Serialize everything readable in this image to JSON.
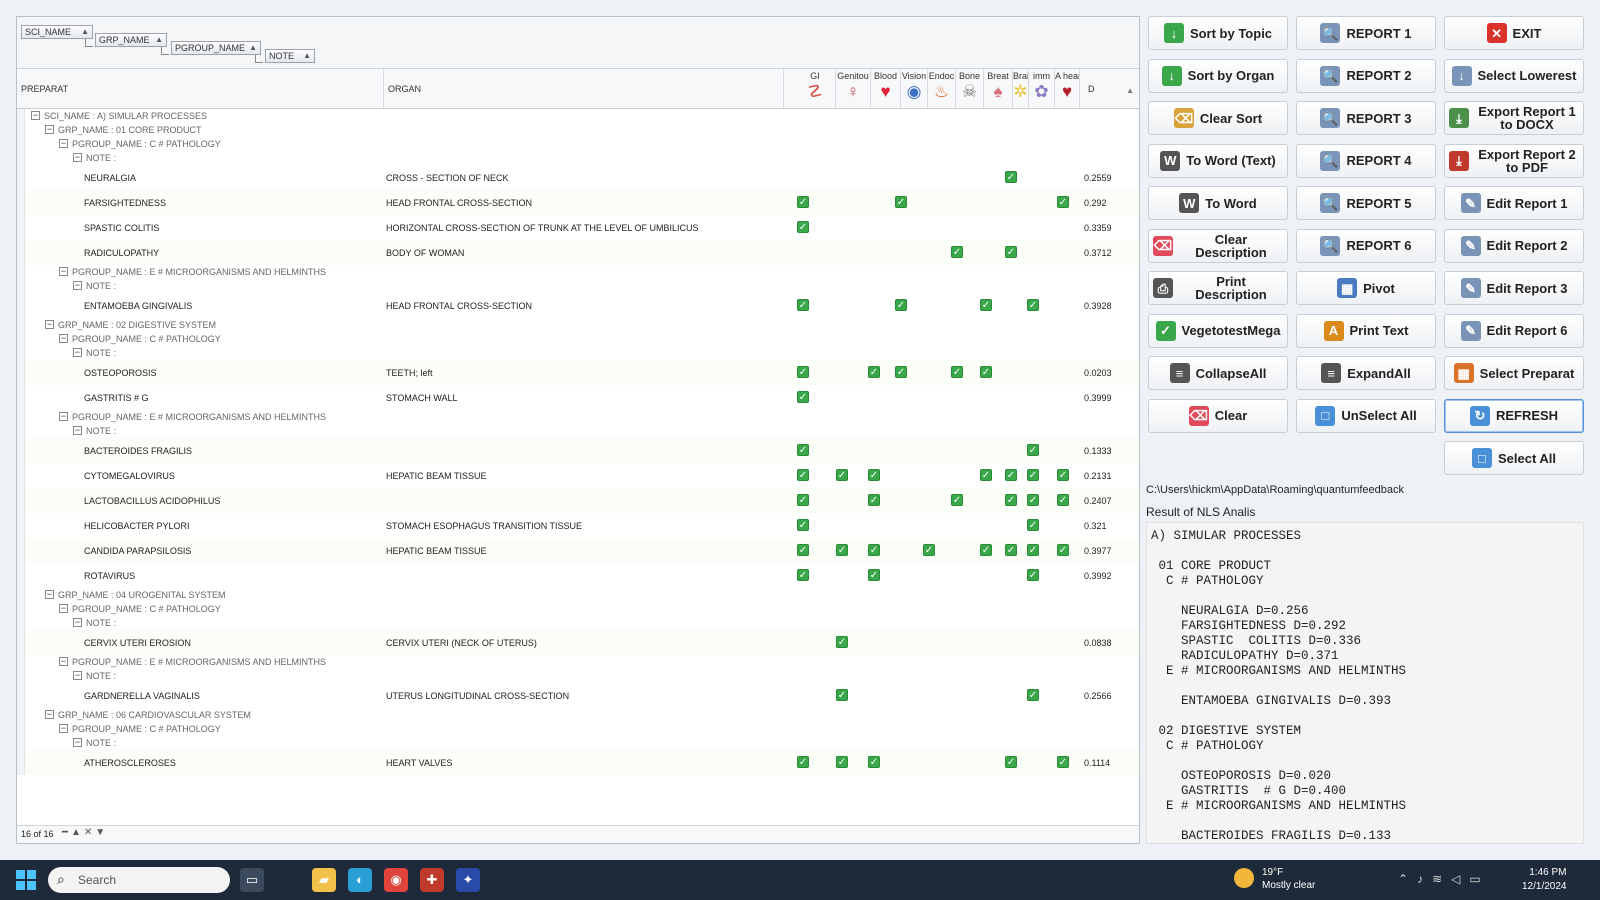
{
  "group_panel": {
    "chips": [
      {
        "label": "SCI_NAME"
      },
      {
        "label": "GRP_NAME"
      },
      {
        "label": "PGROUP_NAME"
      },
      {
        "label": "NOTE"
      }
    ]
  },
  "columns": {
    "preparat": "PREPARAT",
    "organ": "ORGAN",
    "d": "D",
    "organs": [
      {
        "label": "GI",
        "icon": "intestine-icon",
        "glyph": "☡",
        "color": "#d94a3a"
      },
      {
        "label": "Genitou",
        "icon": "uterus-icon",
        "glyph": "♀",
        "color": "#c9445a"
      },
      {
        "label": "Blood",
        "icon": "heart-blood-icon",
        "glyph": "♥",
        "color": "#e0243b"
      },
      {
        "label": "Vision",
        "icon": "eye-icon",
        "glyph": "◉",
        "color": "#3b6fc4"
      },
      {
        "label": "Endoc",
        "icon": "thyroid-icon",
        "glyph": "♨",
        "color": "#e06b1a"
      },
      {
        "label": "Bone",
        "icon": "skull-icon",
        "glyph": "☠",
        "color": "#777777"
      },
      {
        "label": "Breat",
        "icon": "lungs-icon",
        "glyph": "♠",
        "color": "#d9737a"
      },
      {
        "label": "Brai",
        "icon": "brain-icon",
        "glyph": "✲",
        "color": "#e8c43a"
      },
      {
        "label": "imm",
        "icon": "immune-icon",
        "glyph": "✿",
        "color": "#8c7ac0"
      },
      {
        "label": "A heart",
        "icon": "heart-icon",
        "glyph": "♥",
        "color": "#b81d2a"
      }
    ]
  },
  "rows": [
    {
      "kind": "group",
      "level": 0,
      "label": "SCI_NAME : A) SIMULAR PROCESSES"
    },
    {
      "kind": "group",
      "level": 1,
      "label": "GRP_NAME : 01 CORE PRODUCT"
    },
    {
      "kind": "group",
      "level": 2,
      "label": "PGROUP_NAME : C # PATHOLOGY"
    },
    {
      "kind": "group",
      "level": 3,
      "label": "NOTE :"
    },
    {
      "kind": "data",
      "preparat": "NEURALGIA",
      "organ": "CROSS - SECTION  OF  NECK",
      "checks": [
        0,
        0,
        0,
        0,
        0,
        0,
        0,
        1,
        0,
        0
      ],
      "d": "0.2559"
    },
    {
      "kind": "data",
      "preparat": "FARSIGHTEDNESS",
      "organ": "HEAD FRONTAL CROSS-SECTION",
      "checks": [
        1,
        0,
        0,
        1,
        0,
        0,
        0,
        0,
        0,
        1
      ],
      "d": "0.292"
    },
    {
      "kind": "data",
      "preparat": "SPASTIC  COLITIS",
      "organ": "HORIZONTAL CROSS-SECTION OF TRUNK AT THE LEVEL OF UMBILICUS",
      "checks": [
        1,
        0,
        0,
        0,
        0,
        0,
        0,
        0,
        0,
        0
      ],
      "d": "0.3359"
    },
    {
      "kind": "data",
      "preparat": "RADICULOPATHY",
      "organ": "BODY OF WOMAN",
      "checks": [
        0,
        0,
        0,
        0,
        0,
        1,
        0,
        1,
        0,
        0
      ],
      "d": "0.3712"
    },
    {
      "kind": "group",
      "level": 2,
      "label": "PGROUP_NAME : E # MICROORGANISMS AND HELMINTHS"
    },
    {
      "kind": "group",
      "level": 3,
      "label": "NOTE :"
    },
    {
      "kind": "data",
      "preparat": "ENTAMOEBA GINGIVALIS",
      "organ": "HEAD FRONTAL CROSS-SECTION",
      "checks": [
        1,
        0,
        0,
        1,
        0,
        0,
        1,
        0,
        1,
        0
      ],
      "d": "0.3928"
    },
    {
      "kind": "group",
      "level": 1,
      "label": "GRP_NAME : 02 DIGESTIVE SYSTEM"
    },
    {
      "kind": "group",
      "level": 2,
      "label": "PGROUP_NAME : C # PATHOLOGY"
    },
    {
      "kind": "group",
      "level": 3,
      "label": "NOTE :"
    },
    {
      "kind": "data",
      "preparat": "OSTEOPOROSIS",
      "organ": "TEETH; left",
      "checks": [
        1,
        0,
        1,
        1,
        0,
        1,
        1,
        0,
        0,
        0
      ],
      "d": "0.0203"
    },
    {
      "kind": "data",
      "preparat": "GASTRITIS  # G",
      "organ": "STOMACH WALL",
      "checks": [
        1,
        0,
        0,
        0,
        0,
        0,
        0,
        0,
        0,
        0
      ],
      "d": "0.3999"
    },
    {
      "kind": "group",
      "level": 2,
      "label": "PGROUP_NAME : E # MICROORGANISMS AND HELMINTHS"
    },
    {
      "kind": "group",
      "level": 3,
      "label": "NOTE :"
    },
    {
      "kind": "data",
      "preparat": "BACTEROIDES FRAGILIS",
      "organ": "",
      "checks": [
        1,
        0,
        0,
        0,
        0,
        0,
        0,
        0,
        1,
        0
      ],
      "d": "0.1333"
    },
    {
      "kind": "data",
      "preparat": "CYTOMEGALOVIRUS",
      "organ": "HEPATIC  BEAM TISSUE",
      "checks": [
        1,
        1,
        1,
        0,
        0,
        0,
        1,
        1,
        1,
        1
      ],
      "d": "0.2131"
    },
    {
      "kind": "data",
      "preparat": "LACTOBACILLUS ACIDOPHILUS",
      "organ": "",
      "checks": [
        1,
        0,
        1,
        0,
        0,
        1,
        0,
        1,
        1,
        1
      ],
      "d": "0.2407"
    },
    {
      "kind": "data",
      "preparat": "HELICOBACTER PYLORI",
      "organ": "STOMACH ESOPHAGUS TRANSITION TISSUE",
      "checks": [
        1,
        0,
        0,
        0,
        0,
        0,
        0,
        0,
        1,
        0
      ],
      "d": "0.321"
    },
    {
      "kind": "data",
      "preparat": "CANDIDA PARAPSILOSIS",
      "organ": "HEPATIC  BEAM TISSUE",
      "checks": [
        1,
        1,
        1,
        0,
        1,
        0,
        1,
        1,
        1,
        1
      ],
      "d": "0.3977"
    },
    {
      "kind": "data",
      "preparat": "ROTAVIRUS",
      "organ": "",
      "checks": [
        1,
        0,
        1,
        0,
        0,
        0,
        0,
        0,
        1,
        0
      ],
      "d": "0.3992"
    },
    {
      "kind": "group",
      "level": 1,
      "label": "GRP_NAME : 04 UROGENITAL SYSTEM"
    },
    {
      "kind": "group",
      "level": 2,
      "label": "PGROUP_NAME : C # PATHOLOGY"
    },
    {
      "kind": "group",
      "level": 3,
      "label": "NOTE :"
    },
    {
      "kind": "data",
      "preparat": "CERVIX  UTERI  EROSION",
      "organ": "CERVIX  UTERI (NECK OF UTERUS)",
      "checks": [
        0,
        1,
        0,
        0,
        0,
        0,
        0,
        0,
        0,
        0
      ],
      "d": "0.0838"
    },
    {
      "kind": "group",
      "level": 2,
      "label": "PGROUP_NAME : E # MICROORGANISMS AND HELMINTHS"
    },
    {
      "kind": "group",
      "level": 3,
      "label": "NOTE :"
    },
    {
      "kind": "data",
      "preparat": "GARDNERELLA VAGINALIS",
      "organ": "UTERUS LONGITUDINAL CROSS-SECTION",
      "checks": [
        0,
        1,
        0,
        0,
        0,
        0,
        0,
        0,
        1,
        0
      ],
      "d": "0.2566"
    },
    {
      "kind": "group",
      "level": 1,
      "label": "GRP_NAME : 06 CARDIOVASCULAR SYSTEM"
    },
    {
      "kind": "group",
      "level": 2,
      "label": "PGROUP_NAME : C # PATHOLOGY"
    },
    {
      "kind": "group",
      "level": 3,
      "label": "NOTE :"
    },
    {
      "kind": "data",
      "preparat": "ATHEROSCLEROSES",
      "organ": "HEART VALVES",
      "checks": [
        1,
        1,
        1,
        0,
        0,
        0,
        0,
        1,
        0,
        1
      ],
      "d": "0.1114"
    }
  ],
  "grid_footer": {
    "count": "16 of 16"
  },
  "buttons": [
    {
      "label": "Sort by Topic",
      "icon": "sort-az-icon",
      "glyph": "↓",
      "color": "#3aa84a"
    },
    {
      "label": "REPORT 1",
      "icon": "report-icon",
      "glyph": "🔍",
      "color": "#7a94b8"
    },
    {
      "label": "EXIT",
      "icon": "close-icon",
      "glyph": "✕",
      "color": "#d9332b"
    },
    {
      "label": "Sort by Organ",
      "icon": "sort-az-icon",
      "glyph": "↓",
      "color": "#3aa84a"
    },
    {
      "label": "REPORT 2",
      "icon": "report-icon",
      "glyph": "🔍",
      "color": "#7a94b8"
    },
    {
      "label": "Select Lowerest",
      "icon": "sort-down-icon",
      "glyph": "↓",
      "color": "#7a94b8"
    },
    {
      "label": "Clear Sort",
      "icon": "broom-icon",
      "glyph": "⌫",
      "color": "#d9a23a"
    },
    {
      "label": "REPORT 3",
      "icon": "report-icon",
      "glyph": "🔍",
      "color": "#7a94b8"
    },
    {
      "label": "Export Report 1 to DOCX",
      "icon": "export-docx-icon",
      "glyph": "⤓",
      "color": "#4a8f4a"
    },
    {
      "label": "To Word (Text)",
      "icon": "word-icon",
      "glyph": "W",
      "color": "#555555"
    },
    {
      "label": "REPORT 4",
      "icon": "report-icon",
      "glyph": "🔍",
      "color": "#7a94b8"
    },
    {
      "label": "Export Report 2 to PDF",
      "icon": "export-pdf-icon",
      "glyph": "⤓",
      "color": "#c0392b"
    },
    {
      "label": "To Word",
      "icon": "word-icon",
      "glyph": "W",
      "color": "#555555"
    },
    {
      "label": "REPORT 5",
      "icon": "report-icon",
      "glyph": "🔍",
      "color": "#7a94b8"
    },
    {
      "label": "Edit Report 1",
      "icon": "edit-doc-icon",
      "glyph": "✎",
      "color": "#7a94b8"
    },
    {
      "label": "Clear Description",
      "icon": "eraser-icon",
      "glyph": "⌫",
      "color": "#e04a5a"
    },
    {
      "label": "REPORT 6",
      "icon": "report-icon",
      "glyph": "🔍",
      "color": "#7a94b8"
    },
    {
      "label": "Edit Report 2",
      "icon": "edit-doc-icon",
      "glyph": "✎",
      "color": "#7a94b8"
    },
    {
      "label": "Print Description",
      "icon": "printer-icon",
      "glyph": "⎙",
      "color": "#555555"
    },
    {
      "label": "Pivot",
      "icon": "pivot-icon",
      "glyph": "▦",
      "color": "#4a7ac0"
    },
    {
      "label": "Edit Report 3",
      "icon": "edit-doc-icon",
      "glyph": "✎",
      "color": "#7a94b8"
    },
    {
      "label": "VegetotestMega",
      "icon": "checklist-icon",
      "glyph": "✓",
      "color": "#3aa84a"
    },
    {
      "label": "Print Text",
      "icon": "print-text-icon",
      "glyph": "A",
      "color": "#d98a1a"
    },
    {
      "label": "Edit Report 6",
      "icon": "edit-doc-icon",
      "glyph": "✎",
      "color": "#7a94b8"
    },
    {
      "label": "CollapseAll",
      "icon": "collapse-icon",
      "glyph": "≡",
      "color": "#555555"
    },
    {
      "label": "ExpandAll",
      "icon": "expand-icon",
      "glyph": "≡",
      "color": "#555555"
    },
    {
      "label": "Select Preparat",
      "icon": "grid-select-icon",
      "glyph": "▦",
      "color": "#d9732a"
    },
    {
      "label": "Clear",
      "icon": "eraser-icon",
      "glyph": "⌫",
      "color": "#e04a5a"
    },
    {
      "label": "UnSelect All",
      "icon": "unselect-icon",
      "glyph": "□",
      "color": "#4a90d9"
    },
    {
      "label": "REFRESH",
      "icon": "refresh-icon",
      "glyph": "↻",
      "color": "#4a90d9"
    },
    {
      "label": "Select All",
      "icon": "select-all-icon",
      "glyph": "□",
      "color": "#4a90d9"
    }
  ],
  "path": "C:\\Users\\hickm\\AppData\\Roaming\\quantumfeedback",
  "result_title": "Result of NLS Analis",
  "result_lines": [
    "A) SIMULAR PROCESSES",
    "",
    " 01 CORE PRODUCT",
    "  C # PATHOLOGY",
    "",
    "    NEURALGIA D=0.256",
    "    FARSIGHTEDNESS D=0.292",
    "    SPASTIC  COLITIS D=0.336",
    "    RADICULOPATHY D=0.371",
    "  E # MICROORGANISMS AND HELMINTHS",
    "",
    "    ENTAMOEBA GINGIVALIS D=0.393",
    "",
    " 02 DIGESTIVE SYSTEM",
    "  C # PATHOLOGY",
    "",
    "    OSTEOPOROSIS D=0.020",
    "    GASTRITIS  # G D=0.400",
    "  E # MICROORGANISMS AND HELMINTHS",
    "",
    "    BACTEROIDES FRAGILIS D=0.133"
  ],
  "taskbar": {
    "search_placeholder": "Search",
    "weather_temp": "19°F",
    "weather_desc": "Mostly clear",
    "time": "1:46 PM",
    "date": "12/1/2024",
    "apps": [
      {
        "name": "task-view-icon",
        "glyph": "▭",
        "color": "#3a4a5c"
      },
      {
        "name": "file-explorer-icon",
        "glyph": "▰",
        "color": "#f2c14a"
      },
      {
        "name": "edge-icon",
        "glyph": "◐",
        "color": "#2a9fd6"
      },
      {
        "name": "chrome-icon",
        "glyph": "◉",
        "color": "#e0443a"
      },
      {
        "name": "app-icon",
        "glyph": "✚",
        "color": "#c0392b"
      },
      {
        "name": "active-app-icon",
        "glyph": "✦",
        "color": "#2a4aa8"
      }
    ]
  }
}
